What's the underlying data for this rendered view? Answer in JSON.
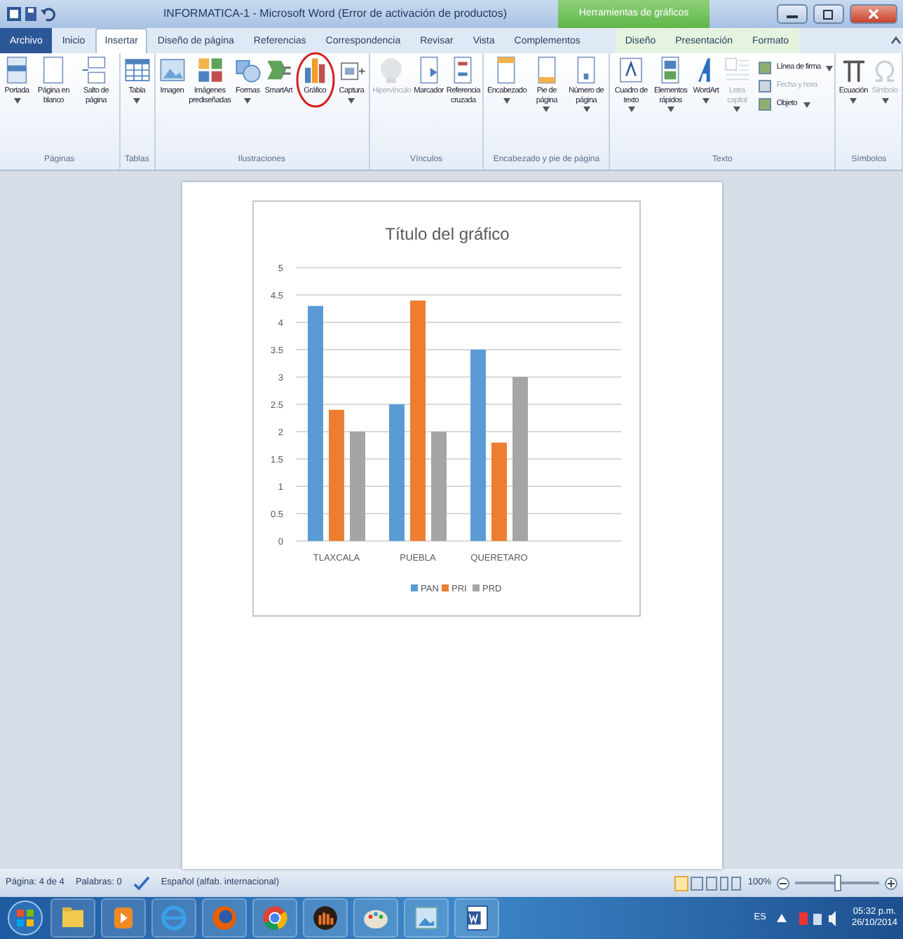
{
  "window": {
    "title": "INFORMATICA-1 - Microsoft Word (Error de activación de productos)",
    "context_tab_group": "Herramientas de gráficos"
  },
  "tabs": [
    {
      "label": "Archivo",
      "kind": "file",
      "selected": false
    },
    {
      "label": "Inicio",
      "kind": "tab",
      "selected": false
    },
    {
      "label": "Insertar",
      "kind": "tab",
      "selected": true
    },
    {
      "label": "Diseño de página",
      "kind": "tab",
      "selected": false
    },
    {
      "label": "Referencias",
      "kind": "tab",
      "selected": false
    },
    {
      "label": "Correspondencia",
      "kind": "tab",
      "selected": false
    },
    {
      "label": "Revisar",
      "kind": "tab",
      "selected": false
    },
    {
      "label": "Vista",
      "kind": "tab",
      "selected": false
    },
    {
      "label": "Complementos",
      "kind": "tab",
      "selected": false
    },
    {
      "label": "Diseño",
      "kind": "context",
      "selected": false
    },
    {
      "label": "Presentación",
      "kind": "context",
      "selected": false
    },
    {
      "label": "Formato",
      "kind": "context",
      "selected": false
    }
  ],
  "ribbon": [
    {
      "group": "Páginas",
      "buttons": [
        {
          "label": "Portada",
          "dropdown": true,
          "disabled": false,
          "circled": false
        },
        {
          "label": "Página en blanco",
          "dropdown": false,
          "disabled": false,
          "circled": false
        },
        {
          "label": "Salto de página",
          "dropdown": false,
          "disabled": false,
          "circled": false
        }
      ]
    },
    {
      "group": "Tablas",
      "buttons": [
        {
          "label": "Tabla",
          "dropdown": true,
          "disabled": false,
          "circled": false
        }
      ]
    },
    {
      "group": "Ilustraciones",
      "buttons": [
        {
          "label": "Imagen",
          "dropdown": false,
          "disabled": false,
          "circled": false
        },
        {
          "label": "Imágenes prediseñadas",
          "dropdown": false,
          "disabled": false,
          "circled": false
        },
        {
          "label": "Formas",
          "dropdown": true,
          "disabled": false,
          "circled": false
        },
        {
          "label": "SmartArt",
          "dropdown": false,
          "disabled": false,
          "circled": false
        },
        {
          "label": "Gráfico",
          "dropdown": false,
          "disabled": false,
          "circled": true
        },
        {
          "label": "Captura",
          "dropdown": true,
          "disabled": false,
          "circled": false
        }
      ]
    },
    {
      "group": "Vínculos",
      "buttons": [
        {
          "label": "Hipervínculo",
          "dropdown": false,
          "disabled": true,
          "circled": false
        },
        {
          "label": "Marcador",
          "dropdown": false,
          "disabled": false,
          "circled": false
        },
        {
          "label": "Referencia cruzada",
          "dropdown": false,
          "disabled": false,
          "circled": false
        }
      ]
    },
    {
      "group": "Encabezado y pie de página",
      "buttons": [
        {
          "label": "Encabezado",
          "dropdown": true,
          "disabled": false,
          "circled": false
        },
        {
          "label": "Pie de página",
          "dropdown": true,
          "disabled": false,
          "circled": false
        },
        {
          "label": "Número de página",
          "dropdown": true,
          "disabled": false,
          "circled": false
        }
      ]
    },
    {
      "group": "Texto",
      "buttons": [
        {
          "label": "Cuadro de texto",
          "dropdown": true,
          "disabled": false,
          "circled": false
        },
        {
          "label": "Elementos rápidos",
          "dropdown": true,
          "disabled": false,
          "circled": false
        },
        {
          "label": "WordArt",
          "dropdown": true,
          "disabled": false,
          "circled": false
        },
        {
          "label": "Letra capital",
          "dropdown": true,
          "disabled": true,
          "circled": false
        }
      ],
      "small_buttons": [
        {
          "label": "Línea de firma",
          "dropdown": true,
          "disabled": false
        },
        {
          "label": "Fecha y hora",
          "dropdown": false,
          "disabled": true
        },
        {
          "label": "Objeto",
          "dropdown": true,
          "disabled": false
        }
      ]
    },
    {
      "group": "Símbolos",
      "buttons": [
        {
          "label": "Ecuación",
          "dropdown": true,
          "disabled": false,
          "circled": false
        },
        {
          "label": "Símbolo",
          "dropdown": true,
          "disabled": true,
          "circled": false
        }
      ]
    }
  ],
  "chart": {
    "chart_data": {
      "type": "bar",
      "title": "Título del gráfico",
      "categories": [
        "TLAXCALA",
        "PUEBLA",
        "QUERETARO"
      ],
      "series": [
        {
          "name": "PAN",
          "color": "#5b9bd5",
          "values": [
            4.3,
            2.5,
            3.5
          ]
        },
        {
          "name": "PRI",
          "color": "#ed7d31",
          "values": [
            2.4,
            4.4,
            1.8
          ]
        },
        {
          "name": "PRD",
          "color": "#a5a5a5",
          "values": [
            2,
            2,
            3
          ]
        }
      ],
      "grid": true,
      "legend": true,
      "ylim": [
        0,
        5
      ],
      "yticks": [
        0,
        {
          "value": 0.5,
          "label": "0.5"
        },
        1,
        {
          "value": 1.5,
          "label": "1.5"
        },
        2,
        {
          "value": 2.5,
          "label": "2.5"
        },
        3,
        {
          "value": 3.5,
          "label": "3.5"
        },
        4,
        {
          "value": 4.5,
          "label": "4.5"
        },
        5
      ]
    }
  },
  "status_bar": {
    "page": "Página: 4 de 4",
    "words": "Palabras: 0",
    "language": "Español (alfab. internacional)",
    "zoom": "100%",
    "zoom_slider": {
      "level": 0.5
    }
  },
  "taskbar": {
    "language": "ES",
    "time": "05:32 p.m.",
    "date": "26/10/2014"
  }
}
